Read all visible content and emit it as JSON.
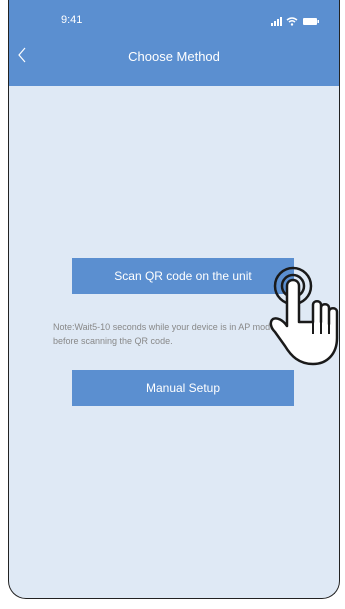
{
  "status_bar": {
    "time": "9:41",
    "icons": [
      "signal-icon",
      "wifi-icon",
      "battery-icon"
    ]
  },
  "header": {
    "back_icon": "chevron-left-icon",
    "title": "Choose Method"
  },
  "main": {
    "scan_button_label": "Scan QR code on the unit",
    "note": "Note:Wait5-10 seconds while your device is in AP mode before scanning the QR code.",
    "manual_button_label": "Manual Setup"
  },
  "overlay": {
    "icon": "tap-hand-icon"
  },
  "colors": {
    "primary": "#5b8fd0",
    "background": "#dfe9f5",
    "note_text": "#888888"
  }
}
